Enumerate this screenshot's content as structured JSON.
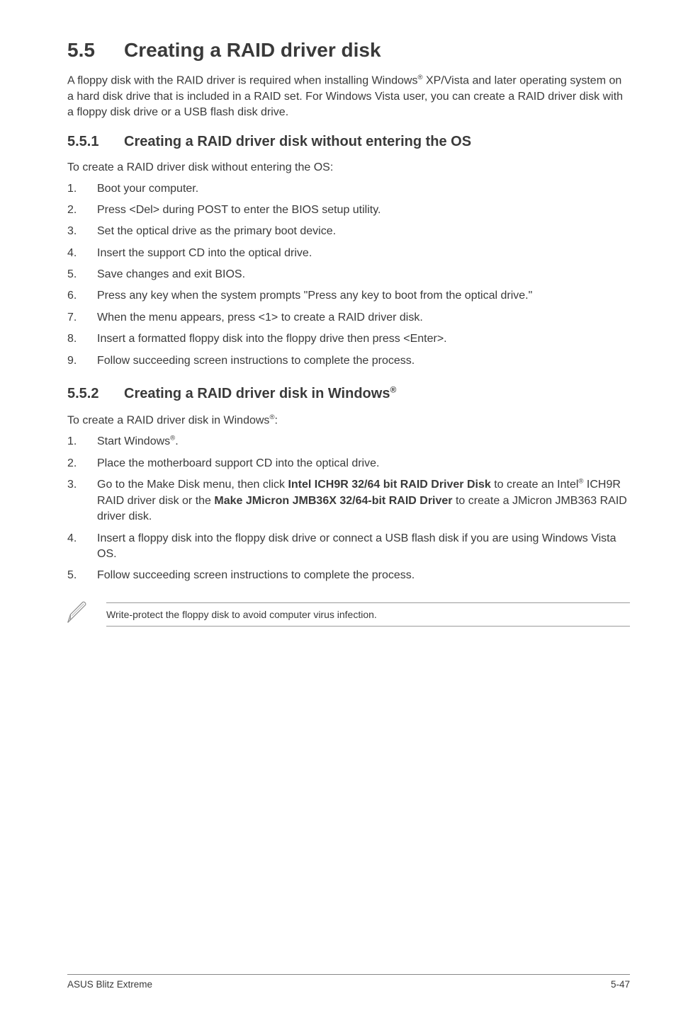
{
  "h1": {
    "num": "5.5",
    "title": "Creating a RAID driver disk"
  },
  "intro": {
    "p1a": "A floppy disk with the RAID driver is required when installing Windows",
    "sup1": "®",
    "p1b": " XP/Vista and later operating system on a hard disk drive that is included in a RAID set. For Windows Vista user, you can create a RAID driver disk with a floppy disk drive or a USB flash disk drive."
  },
  "s1": {
    "num": "5.5.1",
    "title": "Creating a RAID driver disk without entering the OS",
    "lead": "To create a RAID driver disk without entering the OS:",
    "items": [
      "Boot your computer.",
      "Press <Del> during POST to enter the BIOS setup utility.",
      "Set the optical drive as the primary boot device.",
      "Insert the support CD into the optical drive.",
      "Save changes and exit BIOS.",
      "Press any key when the system prompts \"Press any key to boot from the optical drive.\"",
      "When the menu appears, press <1> to create a RAID driver disk.",
      "Insert a formatted floppy disk into the floppy drive then press <Enter>.",
      "Follow succeeding screen instructions to complete the process."
    ]
  },
  "s2": {
    "num": "5.5.2",
    "title_a": "Creating a RAID driver disk in Windows",
    "title_sup": "®",
    "lead_a": "To create a RAID driver disk in Windows",
    "lead_sup": "®",
    "lead_b": ":",
    "items": {
      "i1a": "Start Windows",
      "i1sup": "®",
      "i1b": ".",
      "i2": "Place the motherboard support CD into the optical drive.",
      "i3a": "Go to the Make Disk menu, then click ",
      "i3b1": "Intel ICH9R 32/64 bit RAID Driver Disk",
      "i3c": " to create an Intel",
      "i3sup": "®",
      "i3d": " ICH9R RAID driver disk or the ",
      "i3b2": "Make JMicron JMB36X 32/64-bit RAID Driver",
      "i3e": " to create a JMicron JMB363 RAID driver disk.",
      "i4": "Insert a floppy disk into the floppy disk drive or connect a USB flash disk if you are using Windows Vista OS.",
      "i5": "Follow succeeding screen instructions to complete the process."
    }
  },
  "note": "Write-protect the floppy disk to avoid computer virus infection.",
  "footer": {
    "left": "ASUS Blitz Extreme",
    "right": "5-47"
  },
  "nums": [
    "1.",
    "2.",
    "3.",
    "4.",
    "5.",
    "6.",
    "7.",
    "8.",
    "9."
  ]
}
